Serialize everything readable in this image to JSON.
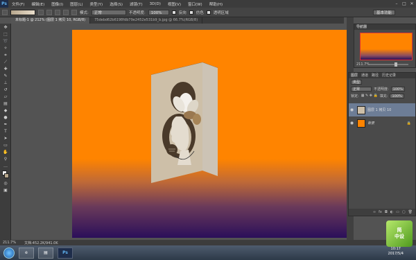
{
  "app": {
    "logo": "Ps"
  },
  "menu": [
    "文件(F)",
    "编辑(E)",
    "图像(I)",
    "图层(L)",
    "类型(Y)",
    "选择(S)",
    "滤镜(T)",
    "3D(D)",
    "视图(V)",
    "窗口(W)",
    "帮助(H)"
  ],
  "options": {
    "mode_label": "模式:",
    "mode_value": "正常",
    "opacity_label": "不透明度:",
    "opacity_value": "100%",
    "reverse_label": "反向",
    "dither_label": "仿色",
    "transparency_label": "透明区域",
    "workspace": "基本功能"
  },
  "tabs": [
    "未标题-1 @ 212% (图层 1 拷贝 10, RGB/8)",
    "75debd62b6198fdb79e2452e531b9_b.jpg @ 66.7%(RGB/8)"
  ],
  "status": {
    "zoom": "211.7%",
    "doc": "文档:452.2K/941.0K"
  },
  "navigator": {
    "title": "导航器",
    "zoom": "211.7%"
  },
  "layers": {
    "tabs": [
      "图层",
      "通道",
      "路径",
      "历史记录"
    ],
    "kind_label": "类型",
    "blend_mode": "正常",
    "opacity_label": "不透明度:",
    "opacity_value": "100%",
    "lock_label": "锁定:",
    "fill_label": "填充:",
    "fill_value": "100%",
    "items": [
      {
        "name": "图层 1 拷贝 10"
      },
      {
        "name": "背景"
      }
    ]
  },
  "taskbar": {
    "time": "10:17",
    "date": "2017/5/4"
  },
  "watermark": "简\n中设",
  "colors": {
    "orange": "#ff8400",
    "purple": "#2b0f5a",
    "selected_layer": "#6d7d96"
  }
}
